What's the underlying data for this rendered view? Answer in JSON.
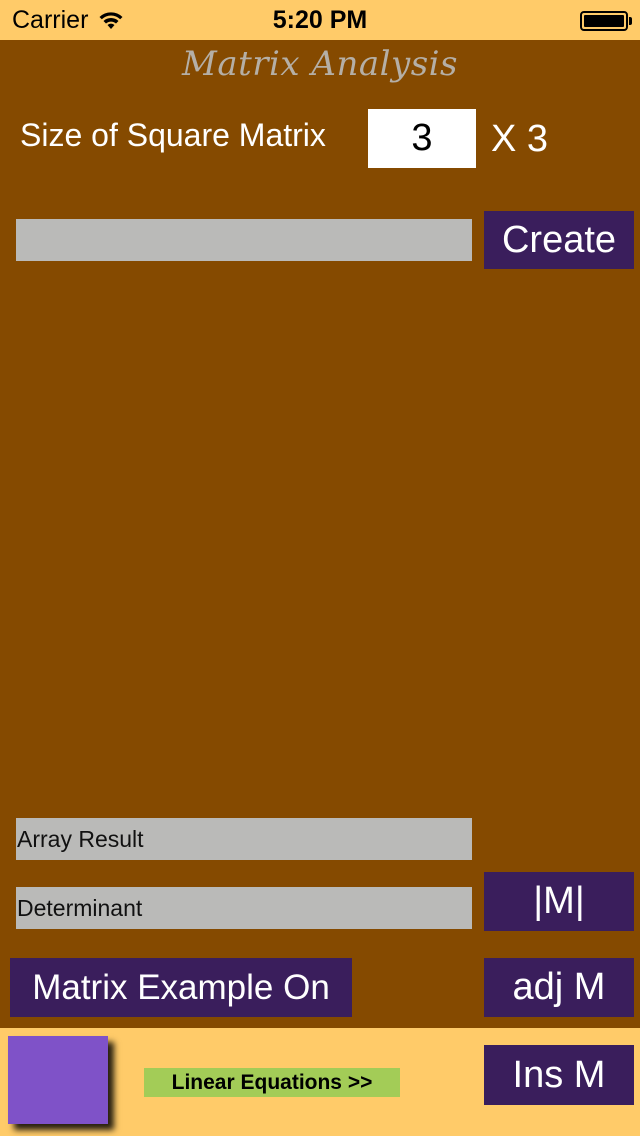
{
  "status_bar": {
    "carrier": "Carrier",
    "time": "5:20 PM",
    "wifi_icon": "wifi-icon",
    "battery_icon": "battery-full-icon"
  },
  "app": {
    "title": "Matrix Analysis"
  },
  "size_row": {
    "label": "Size of Square Matrix",
    "input_value": "3",
    "suffix": "X 3"
  },
  "matrix_field": {
    "value": ""
  },
  "buttons": {
    "create": "Create",
    "determinant": "|M|",
    "adjoint": "adj M",
    "inverse": "Ins M",
    "example_toggle": "Matrix Example On",
    "linear_equations": "Linear Equations >>"
  },
  "results": {
    "array_result": "Array Result",
    "determinant": "Determinant"
  },
  "colors": {
    "status_bar_bg": "#FFCB69",
    "main_bg": "#854A00",
    "button_bg": "#3A1E5C",
    "field_bg": "#BABAB8",
    "link_bg": "#A3CC57",
    "square": "#7F52C8"
  }
}
